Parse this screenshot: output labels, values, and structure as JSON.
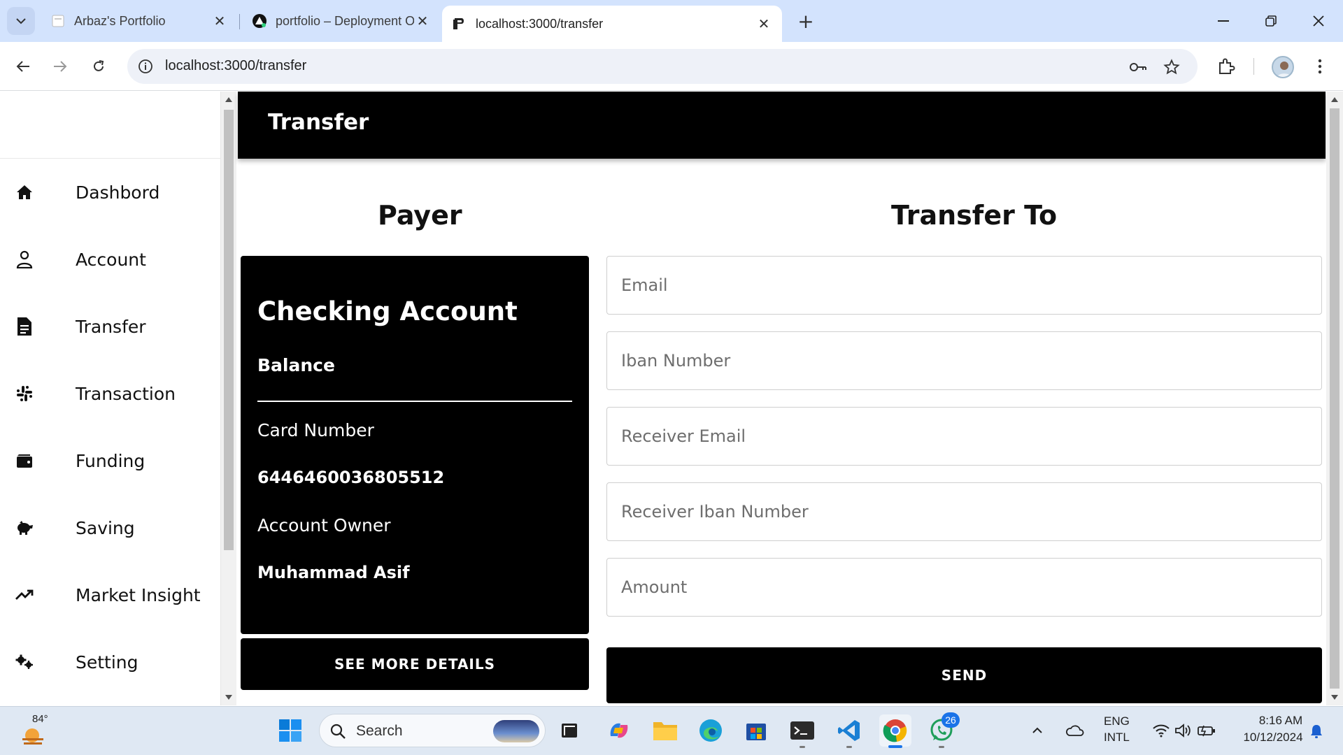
{
  "browser": {
    "tabs": [
      {
        "title": "Arbaz's Portfolio",
        "favicon": "page-icon"
      },
      {
        "title": "portfolio – Deployment Overvie",
        "favicon": "vercel-icon"
      },
      {
        "title": "localhost:3000/transfer",
        "favicon": "app-icon"
      }
    ],
    "active_tab_index": 2,
    "url": "localhost:3000/transfer"
  },
  "sidebar": {
    "items": [
      {
        "label": "Dashbord",
        "icon": "home-icon"
      },
      {
        "label": "Account",
        "icon": "user-icon"
      },
      {
        "label": "Transfer",
        "icon": "document-icon"
      },
      {
        "label": "Transaction",
        "icon": "slack-icon"
      },
      {
        "label": "Funding",
        "icon": "wallet-icon"
      },
      {
        "label": "Saving",
        "icon": "piggy-bank-icon"
      },
      {
        "label": "Market Insight",
        "icon": "trending-up-icon"
      },
      {
        "label": "Setting",
        "icon": "gears-icon"
      }
    ]
  },
  "header": {
    "title": "Transfer"
  },
  "payer": {
    "heading": "Payer",
    "card": {
      "account_type": "Checking Account",
      "balance_label": "Balance",
      "card_number_label": "Card Number",
      "card_number": "6446460036805512",
      "owner_label": "Account Owner",
      "owner_name": "Muhammad Asif"
    },
    "details_button": "SEE MORE DETAILS"
  },
  "transfer_to": {
    "heading": "Transfer To",
    "fields": {
      "email": "Email",
      "iban": "Iban Number",
      "receiver_email": "Receiver Email",
      "receiver_iban": "Receiver Iban Number",
      "amount": "Amount"
    },
    "send_button": "SEND"
  },
  "taskbar": {
    "weather_temp": "84°",
    "search_label": "Search",
    "notification_count": "26",
    "language_line1": "ENG",
    "language_line2": "INTL",
    "time": "8:16 AM",
    "date": "10/12/2024"
  },
  "colors": {
    "tabstrip": "#d3e3fd",
    "primary_dark": "#000000",
    "accent_blue": "#1a73e8"
  }
}
